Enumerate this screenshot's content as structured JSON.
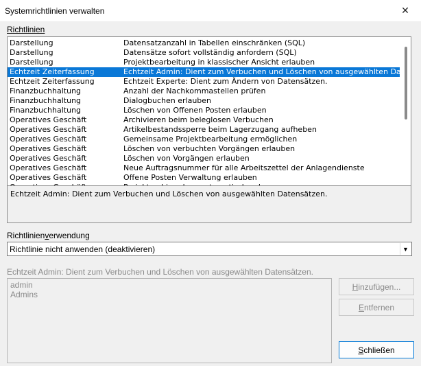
{
  "window": {
    "title": "Systemrichtlinien verwalten",
    "close_label": "✕"
  },
  "policies": {
    "label": "Richtlinien",
    "rows": [
      {
        "category": "Darstellung",
        "description": "Datensatzanzahl in Tabellen einschränken (SQL)"
      },
      {
        "category": "Darstellung",
        "description": "Datensätze sofort vollständig anfordern (SQL)"
      },
      {
        "category": "Darstellung",
        "description": "Projektbearbeitung in klassischer Ansicht erlauben"
      },
      {
        "category": "Echtzeit Zeiterfassung",
        "description": "Echtzeit Admin: Dient zum Verbuchen und Löschen von ausgewählten Da",
        "selected": true
      },
      {
        "category": "Echtzeit Zeiterfassung",
        "description": "Echtzeit Experte: Dient zum Ändern von Datensätzen."
      },
      {
        "category": "Finanzbuchhaltung",
        "description": "Anzahl der Nachkommastellen prüfen"
      },
      {
        "category": "Finanzbuchhaltung",
        "description": "Dialogbuchen erlauben"
      },
      {
        "category": "Finanzbuchhaltung",
        "description": "Löschen von Offenen Posten erlauben"
      },
      {
        "category": "Operatives Geschäft",
        "description": "Archivieren beim beleglosen Verbuchen"
      },
      {
        "category": "Operatives Geschäft",
        "description": "Artikelbestandssperre beim Lagerzugang aufheben"
      },
      {
        "category": "Operatives Geschäft",
        "description": "Gemeinsame Projektbearbeitung ermöglichen"
      },
      {
        "category": "Operatives Geschäft",
        "description": "Löschen von verbuchten Vorgängen erlauben"
      },
      {
        "category": "Operatives Geschäft",
        "description": "Löschen von Vorgängen erlauben"
      },
      {
        "category": "Operatives Geschäft",
        "description": "Neue Auftragsnummer für alle Arbeitszettel der Anlagendienste"
      },
      {
        "category": "Operatives Geschäft",
        "description": "Offene Posten Verwaltung erlauben"
      },
      {
        "category": "Operatives Geschäft",
        "description": "Projektarchivordner automatisch anlegen"
      }
    ]
  },
  "description_box": {
    "text": "Echtzeit Admin: Dient zum Verbuchen und Löschen von ausgewählten Datensätzen."
  },
  "usage": {
    "label_prefix": "Richtlinien",
    "label_underlined": "v",
    "label_suffix": "erwendung",
    "selected": "Richtlinie nicht anwenden (deaktivieren)"
  },
  "users": {
    "caption": "Echtzeit Admin: Dient zum Verbuchen und Löschen von ausgewählten Datensätzen.",
    "items": [
      "admin",
      "Admins"
    ]
  },
  "buttons": {
    "add_u": "H",
    "add_rest": "inzufügen...",
    "remove_u": "E",
    "remove_rest": "ntfernen",
    "close_u": "S",
    "close_rest": "chließen"
  },
  "colors": {
    "selection": "#0a78d7",
    "focus_border": "#0078d7"
  }
}
